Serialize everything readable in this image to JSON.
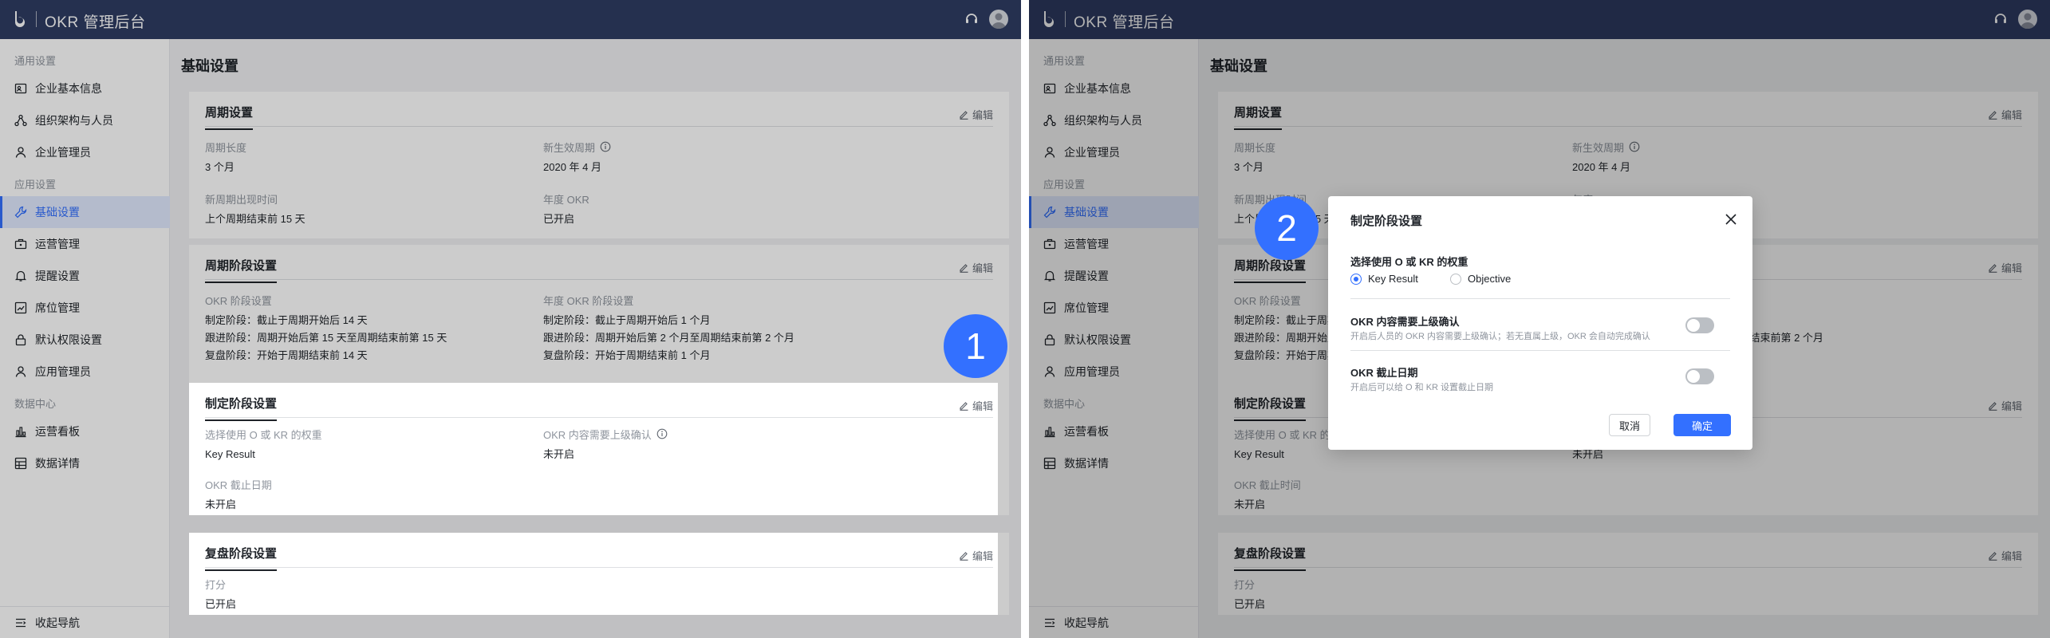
{
  "app": {
    "title": "OKR 管理后台"
  },
  "sidebar": {
    "groups": {
      "general": "通用设置",
      "app": "应用设置",
      "data": "数据中心"
    },
    "items": [
      {
        "label": "企业基本信息",
        "icon": "id-card-icon"
      },
      {
        "label": "组织架构与人员",
        "icon": "org-tree-icon"
      },
      {
        "label": "企业管理员",
        "icon": "user-icon"
      },
      {
        "label": "基础设置",
        "icon": "wrench-icon"
      },
      {
        "label": "运营管理",
        "icon": "briefcase-icon"
      },
      {
        "label": "提醒设置",
        "icon": "bell-icon"
      },
      {
        "label": "席位管理",
        "icon": "chart-box-icon"
      },
      {
        "label": "默认权限设置",
        "icon": "lock-icon"
      },
      {
        "label": "应用管理员",
        "icon": "user-icon"
      },
      {
        "label": "运营看板",
        "icon": "bar-chart-icon"
      },
      {
        "label": "数据详情",
        "icon": "table-icon"
      }
    ],
    "collapse": "收起导航"
  },
  "page": {
    "title": "基础设置",
    "edit_label": "编辑",
    "period": {
      "title": "周期设置",
      "length_label": "周期长度",
      "length_value": "3 个月",
      "effective_label": "新生效周期",
      "effective_value": "2020 年 4 月",
      "new_time_label": "新周期出现时间",
      "new_time_value": "上个周期结束前 15 天",
      "annual_label": "年度 OKR",
      "annual_value": "已开启"
    },
    "stage": {
      "title": "周期阶段设置",
      "okr_label": "OKR 阶段设置",
      "okr_lines": [
        "制定阶段：截止于周期开始后 14 天",
        "跟进阶段：周期开始后第 15 天至周期结束前第 15 天",
        "复盘阶段：开始于周期结束前 14 天"
      ],
      "annual_label": "年度 OKR 阶段设置",
      "annual_lines": [
        "制定阶段：截止于周期开始后 1 个月",
        "跟进阶段：周期开始后第 2 个月至周期结束前第 2 个月",
        "复盘阶段：开始于周期结束前 1 个月"
      ]
    },
    "define": {
      "title": "制定阶段设置",
      "weight_label": "选择使用 O 或 KR 的权重",
      "weight_value": "Key Result",
      "confirm_label": "OKR 内容需要上级确认",
      "confirm_value": "未开启",
      "deadline_label": "OKR 截止日期",
      "deadline_label_right": "OKR 截止时间",
      "deadline_value": "未开启"
    },
    "review": {
      "title": "复盘阶段设置",
      "score_label": "打分",
      "score_value": "已开启"
    }
  },
  "badges": {
    "first": "1",
    "second": "2"
  },
  "modal": {
    "title": "制定阶段设置",
    "weight_label": "选择使用 O 或 KR 的权重",
    "options": [
      "Key Result",
      "Objective"
    ],
    "selected": "Key Result",
    "confirm_title": "OKR 内容需要上级确认",
    "confirm_desc": "开启后人员的 OKR 内容需要上级确认；若无直属上级，OKR 会自动完成确认",
    "confirm_on": false,
    "deadline_title": "OKR 截止日期",
    "deadline_desc": "开启后可以给 O 和 KR 设置截止日期",
    "deadline_on": false,
    "cancel": "取消",
    "ok": "确定"
  },
  "colors": {
    "topbar": "#2f3c63",
    "accent": "#3370ff"
  }
}
